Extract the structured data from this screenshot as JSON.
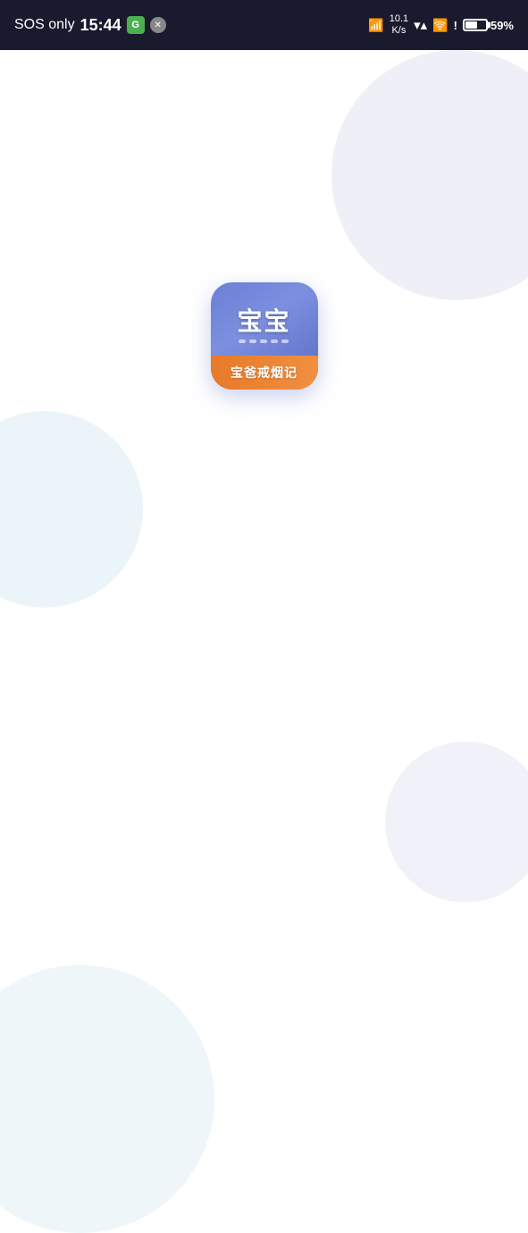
{
  "statusBar": {
    "sosText": "SOS only",
    "time": "15:44",
    "networkSpeed": "10.1\nK/s",
    "batteryPercent": "59%",
    "icons": {
      "g": "G",
      "x": "✕"
    }
  },
  "appIcon": {
    "mainText": "宝宝",
    "subtitleText": "宝爸戒烟记"
  },
  "decorativeCircles": {
    "topRight": {
      "color": "#e8e8f5"
    },
    "leftMid": {
      "color": "#ddeef5"
    },
    "bottomRight": {
      "color": "#e8e8f5"
    },
    "bottomLeft": {
      "color": "#ddeef5"
    }
  }
}
